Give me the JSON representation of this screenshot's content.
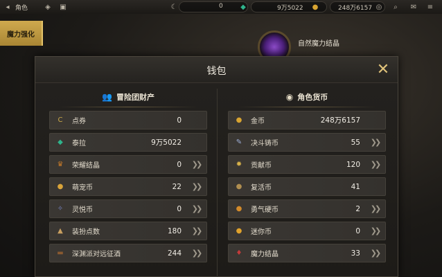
{
  "topbar": {
    "menu_label": "角色",
    "first_currency_value": "0",
    "second_currency_value": "9万5022",
    "third_currency_value": "248万6157"
  },
  "side_tab": {
    "label": "魔力强化"
  },
  "background_item": {
    "title": "自然魔力结晶"
  },
  "dialog": {
    "title": "钱包"
  },
  "left_panel": {
    "title": "冒险团财产",
    "items": [
      {
        "label": "点券",
        "value": "0",
        "icon": "c-coin-icon",
        "icon_color": "#c9a84a"
      },
      {
        "label": "泰拉",
        "value": "9万5022",
        "icon": "tera-crystal-icon",
        "icon_color": "#2fb48c"
      },
      {
        "label": "荣耀结晶",
        "value": "0",
        "icon": "trophy-icon",
        "icon_color": "#c57a2a"
      },
      {
        "label": "萌宠币",
        "value": "22",
        "icon": "pet-coin-icon",
        "icon_color": "#d9a43a"
      },
      {
        "label": "灵悦币",
        "value": "0",
        "icon": "spirit-coin-icon",
        "icon_color": "#7a86c8"
      },
      {
        "label": "装扮点数",
        "value": "180",
        "icon": "costume-point-icon",
        "icon_color": "#c9a060"
      },
      {
        "label": "深渊派对远征酒",
        "value": "244",
        "icon": "abyss-wine-icon",
        "icon_color": "#8a5a30"
      }
    ]
  },
  "right_panel": {
    "title": "角色货币",
    "items": [
      {
        "label": "金币",
        "value": "248万6157",
        "icon": "gold-coin-icon",
        "icon_color": "#d8a431"
      },
      {
        "label": "决斗铸币",
        "value": "55",
        "icon": "duel-coin-icon",
        "icon_color": "#9fb0d8"
      },
      {
        "label": "贡献币",
        "value": "120",
        "icon": "contribution-coin-icon",
        "icon_color": "#d8b24a"
      },
      {
        "label": "复活币",
        "value": "41",
        "icon": "revive-coin-icon",
        "icon_color": "#b08e50"
      },
      {
        "label": "勇气硬币",
        "value": "2",
        "icon": "courage-coin-icon",
        "icon_color": "#d28a2a"
      },
      {
        "label": "迷你币",
        "value": "0",
        "icon": "mini-coin-icon",
        "icon_color": "#e0a22c"
      },
      {
        "label": "魔力结晶",
        "value": "33",
        "icon": "magic-crystal-icon",
        "icon_color": "#c43a3a"
      }
    ]
  }
}
